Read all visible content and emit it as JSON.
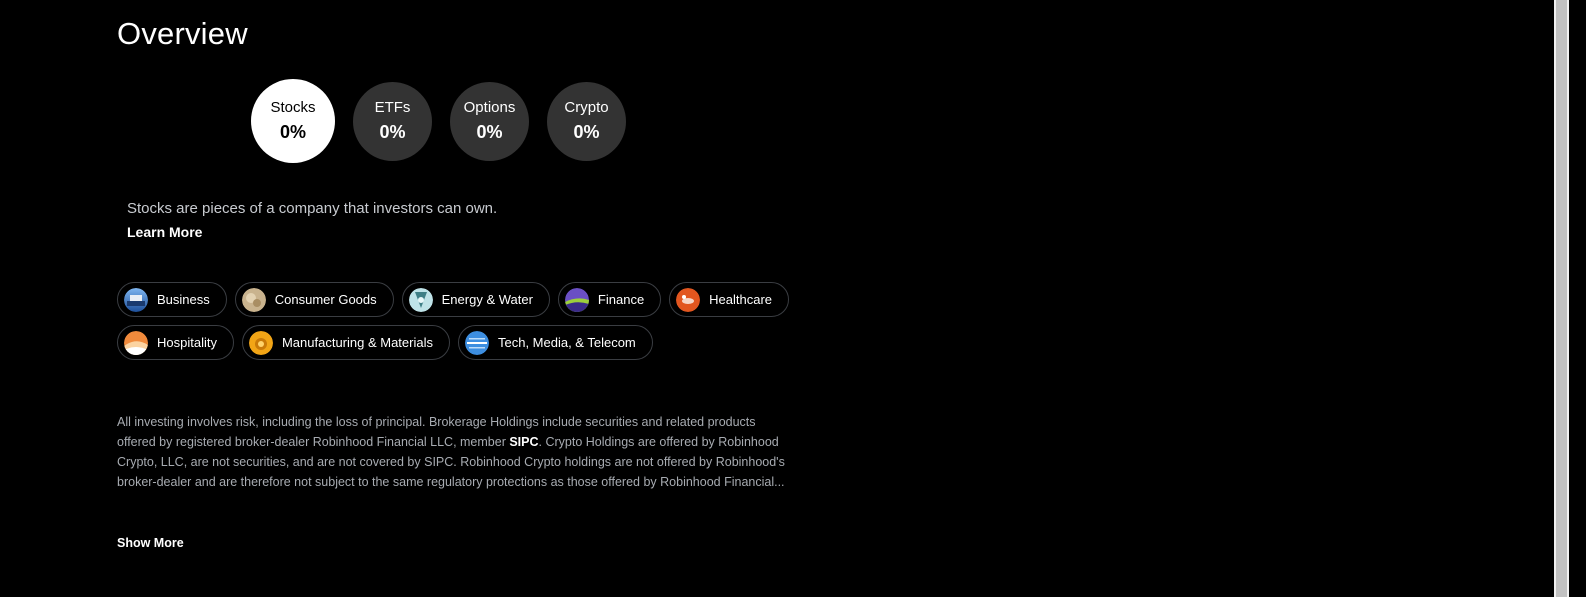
{
  "page": {
    "title": "Overview"
  },
  "asset_types": [
    {
      "label": "Stocks",
      "value": "0%",
      "active": true
    },
    {
      "label": "ETFs",
      "value": "0%",
      "active": false
    },
    {
      "label": "Options",
      "value": "0%",
      "active": false
    },
    {
      "label": "Crypto",
      "value": "0%",
      "active": false
    }
  ],
  "description": {
    "text": "Stocks are pieces of a company that investors can own.",
    "learn_more": "Learn More"
  },
  "sectors": [
    {
      "label": "Business",
      "icon": "business-icon"
    },
    {
      "label": "Consumer Goods",
      "icon": "consumer-goods-icon"
    },
    {
      "label": "Energy & Water",
      "icon": "energy-water-icon"
    },
    {
      "label": "Finance",
      "icon": "finance-icon"
    },
    {
      "label": "Healthcare",
      "icon": "healthcare-icon"
    },
    {
      "label": "Hospitality",
      "icon": "hospitality-icon"
    },
    {
      "label": "Manufacturing & Materials",
      "icon": "manufacturing-materials-icon"
    },
    {
      "label": "Tech, Media, & Telecom",
      "icon": "tech-media-telecom-icon"
    }
  ],
  "disclaimer": {
    "part1": "All investing involves risk, including the loss of principal. Brokerage Holdings include securities and related products offered by registered broker-dealer Robinhood Financial LLC, member ",
    "sipc": "SIPC",
    "part2": ". Crypto Holdings are offered by Robinhood Crypto, LLC, are not securities, and are not covered by SIPC. Robinhood Crypto holdings are not offered by Robinhood's broker-dealer and are therefore not subject to the same regulatory protections as those offered by Robinhood Financial...",
    "show_more": "Show More"
  },
  "colors": {
    "background": "#000000",
    "circle_inactive": "#333333",
    "circle_active": "#ffffff",
    "chip_border": "#3a3d42",
    "muted_text": "#a7abb1"
  }
}
